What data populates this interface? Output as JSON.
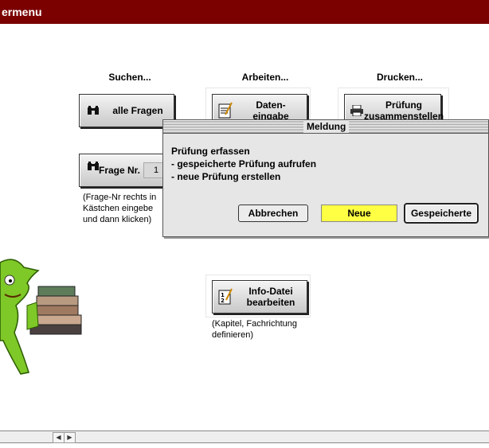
{
  "window": {
    "title": "ermenu"
  },
  "sections": {
    "search": "Suchen...",
    "work": "Arbeiten...",
    "print": "Drucken..."
  },
  "buttons": {
    "all_questions": "alle Fragen",
    "data_entry": "Daten-\neingabe",
    "exam_compose": "Prüfung\nzusammenstellen",
    "question_nr": "Frage Nr.",
    "question_nr_value": "1",
    "info_file": "Info-Datei\nbearbeiten"
  },
  "notes": {
    "question_hint": "(Frage-Nr rechts in\nKästchen eingebe\nund dann klicken)",
    "info_hint": "(Kapitel, Fachrichtung\ndefinieren)"
  },
  "dialog": {
    "title": "Meldung",
    "line1": "Prüfung erfassen",
    "line2": "- gespeicherte Prüfung aufrufen",
    "line3": "- neue Prüfung erstellen",
    "cancel": "Abbrechen",
    "new": "Neue",
    "saved": "Gespeicherte"
  },
  "colors": {
    "titlebar": "#7b0000",
    "new_button": "#ffff44"
  }
}
